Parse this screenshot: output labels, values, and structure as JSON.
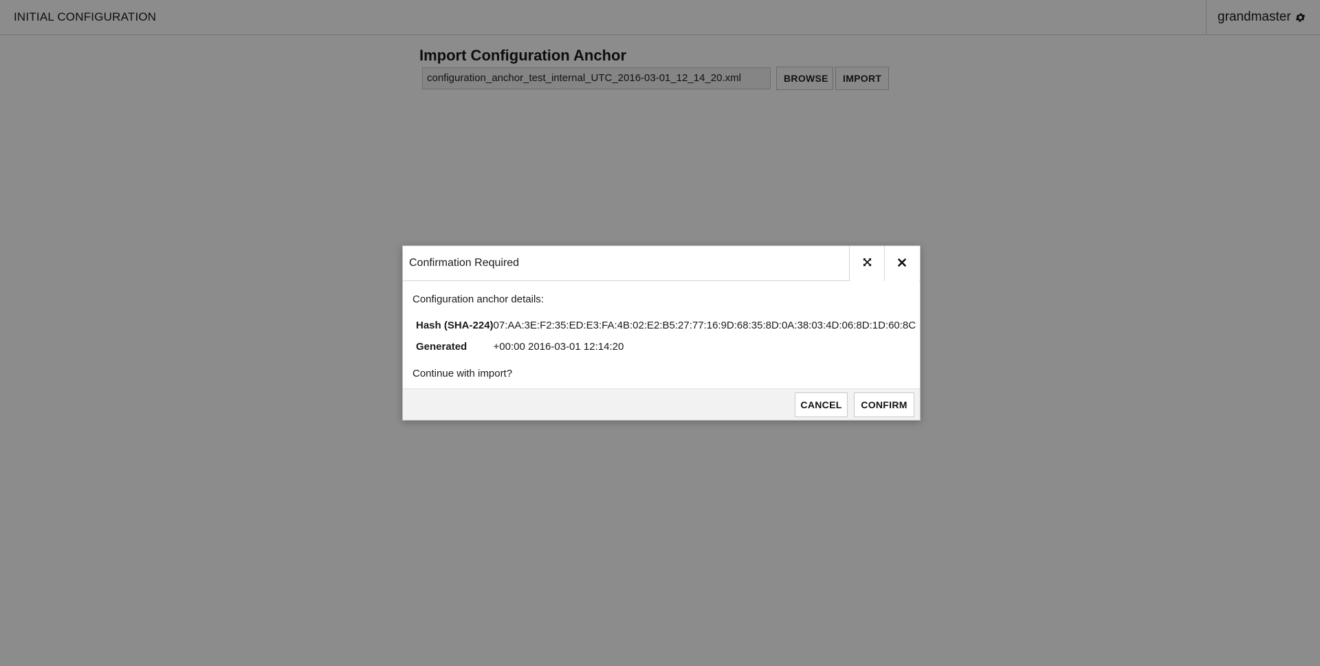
{
  "header": {
    "app_title": "INITIAL CONFIGURATION",
    "username": "grandmaster",
    "user_icon": "gear-icon"
  },
  "import": {
    "title": "Import Configuration Anchor",
    "file_value": "configuration_anchor_test_internal_UTC_2016-03-01_12_14_20.xml",
    "browse_label": "BROWSE",
    "import_label": "IMPORT"
  },
  "dialog": {
    "title": "Confirmation Required",
    "maximize_icon": "maximize-icon",
    "close_icon": "close-icon",
    "intro": "Configuration anchor details:",
    "details": [
      {
        "key": "Hash (SHA-224)",
        "value": "07:AA:3E:F2:35:ED:E3:FA:4B:02:E2:B5:27:77:16:9D:68:35:8D:0A:38:03:4D:06:8D:1D:60:8C"
      },
      {
        "key": "Generated",
        "value": "+00:00 2016-03-01 12:14:20"
      }
    ],
    "question": "Continue with import?",
    "cancel_label": "CANCEL",
    "confirm_label": "CONFIRM"
  },
  "colors": {
    "overlay": "#8c8c8c",
    "footer_bg": "#f2f2f2"
  }
}
